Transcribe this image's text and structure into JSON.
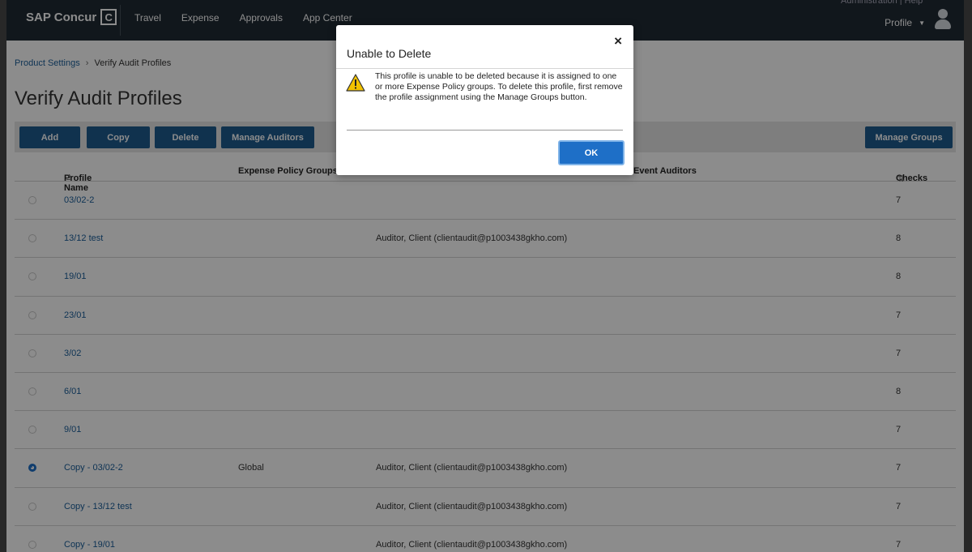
{
  "nav": {
    "brand": "SAP Concur",
    "brand_mark": "C",
    "items": [
      "Travel",
      "Expense",
      "Approvals",
      "App Center"
    ],
    "admin_strip": "Administration  |  Help",
    "profile_label": "Profile",
    "profile_caret": "▼"
  },
  "breadcrumb": {
    "parent": "Product Settings",
    "separator": "›",
    "current": "Verify Audit Profiles"
  },
  "page_title": "Verify Audit Profiles",
  "toolbar": {
    "add": "Add",
    "copy": "Copy",
    "delete": "Delete",
    "manage_auditors": "Manage Auditors",
    "manage_groups": "Manage Groups"
  },
  "table": {
    "headers": {
      "name": "Profile Name",
      "name_sort": "≙",
      "groups": "Expense Policy Groups",
      "auditors": "Event Auditors",
      "checks": "Checks",
      "checks_sort": "⇅"
    },
    "rows": [
      {
        "name": "03/02-2",
        "groups": "",
        "auditors": "",
        "checks": "7",
        "selected": false
      },
      {
        "name": "13/12 test",
        "groups": "",
        "auditors": "Auditor, Client (clientaudit@p1003438gkho.com)",
        "checks": "8",
        "selected": false
      },
      {
        "name": "19/01",
        "groups": "",
        "auditors": "",
        "checks": "8",
        "selected": false
      },
      {
        "name": "23/01",
        "groups": "",
        "auditors": "",
        "checks": "7",
        "selected": false
      },
      {
        "name": "3/02",
        "groups": "",
        "auditors": "",
        "checks": "7",
        "selected": false
      },
      {
        "name": "6/01",
        "groups": "",
        "auditors": "",
        "checks": "8",
        "selected": false
      },
      {
        "name": "9/01",
        "groups": "",
        "auditors": "",
        "checks": "7",
        "selected": false
      },
      {
        "name": "Copy - 03/02-2",
        "groups": "Global",
        "auditors": "Auditor, Client (clientaudit@p1003438gkho.com)",
        "checks": "7",
        "selected": true
      },
      {
        "name": "Copy - 13/12 test",
        "groups": "",
        "auditors": "Auditor, Client (clientaudit@p1003438gkho.com)",
        "checks": "7",
        "selected": false
      },
      {
        "name": "Copy - 19/01",
        "groups": "",
        "auditors": "Auditor, Client (clientaudit@p1003438gkho.com)",
        "checks": "7",
        "selected": false
      }
    ]
  },
  "modal": {
    "title": "Unable to Delete",
    "close": "×",
    "icon": "warning-icon",
    "message": "This profile is unable to be deleted because it is assigned to one or more Expense Policy groups. To delete this profile, first remove the profile assignment using the Manage Groups button.",
    "ok": "OK"
  },
  "colors": {
    "nav_bg": "#202a34",
    "button_primary": "#1e5c8f",
    "link": "#1a5e9a",
    "ok_button": "#1e6fc7",
    "warning_yellow": "#f2c200"
  }
}
